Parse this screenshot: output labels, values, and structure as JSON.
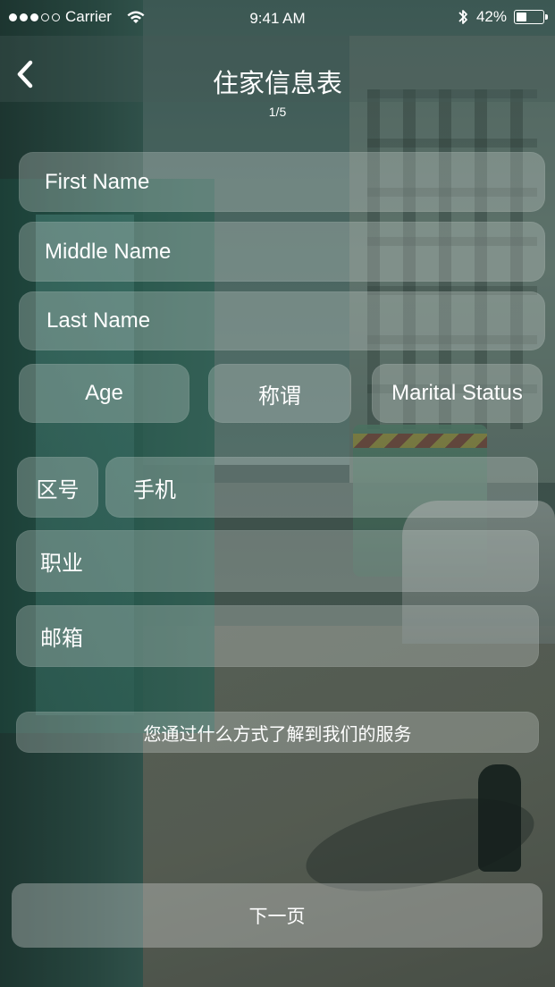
{
  "status_bar": {
    "carrier": "Carrier",
    "time": "9:41 AM",
    "battery": "42%",
    "battery_level": 0.42,
    "signal_strength": 3,
    "signal_max": 5
  },
  "nav": {
    "back_icon": "chevron-left-icon",
    "title": "住家信息表",
    "page_indicator": "1/5"
  },
  "form": {
    "first_name": "First Name",
    "middle_name": "Middle Name",
    "last_name": "Last Name",
    "age": "Age",
    "title": "称谓",
    "marital_status": "Marital Status",
    "area_code": "区号",
    "mobile": "手机",
    "occupation": "职业",
    "email": "邮箱",
    "source": "您通过什么方式了解到我们的服务"
  },
  "footer": {
    "next_label": "下一页"
  },
  "colors": {
    "field_bg": "#d2d6d4",
    "text": "#ffffff"
  }
}
